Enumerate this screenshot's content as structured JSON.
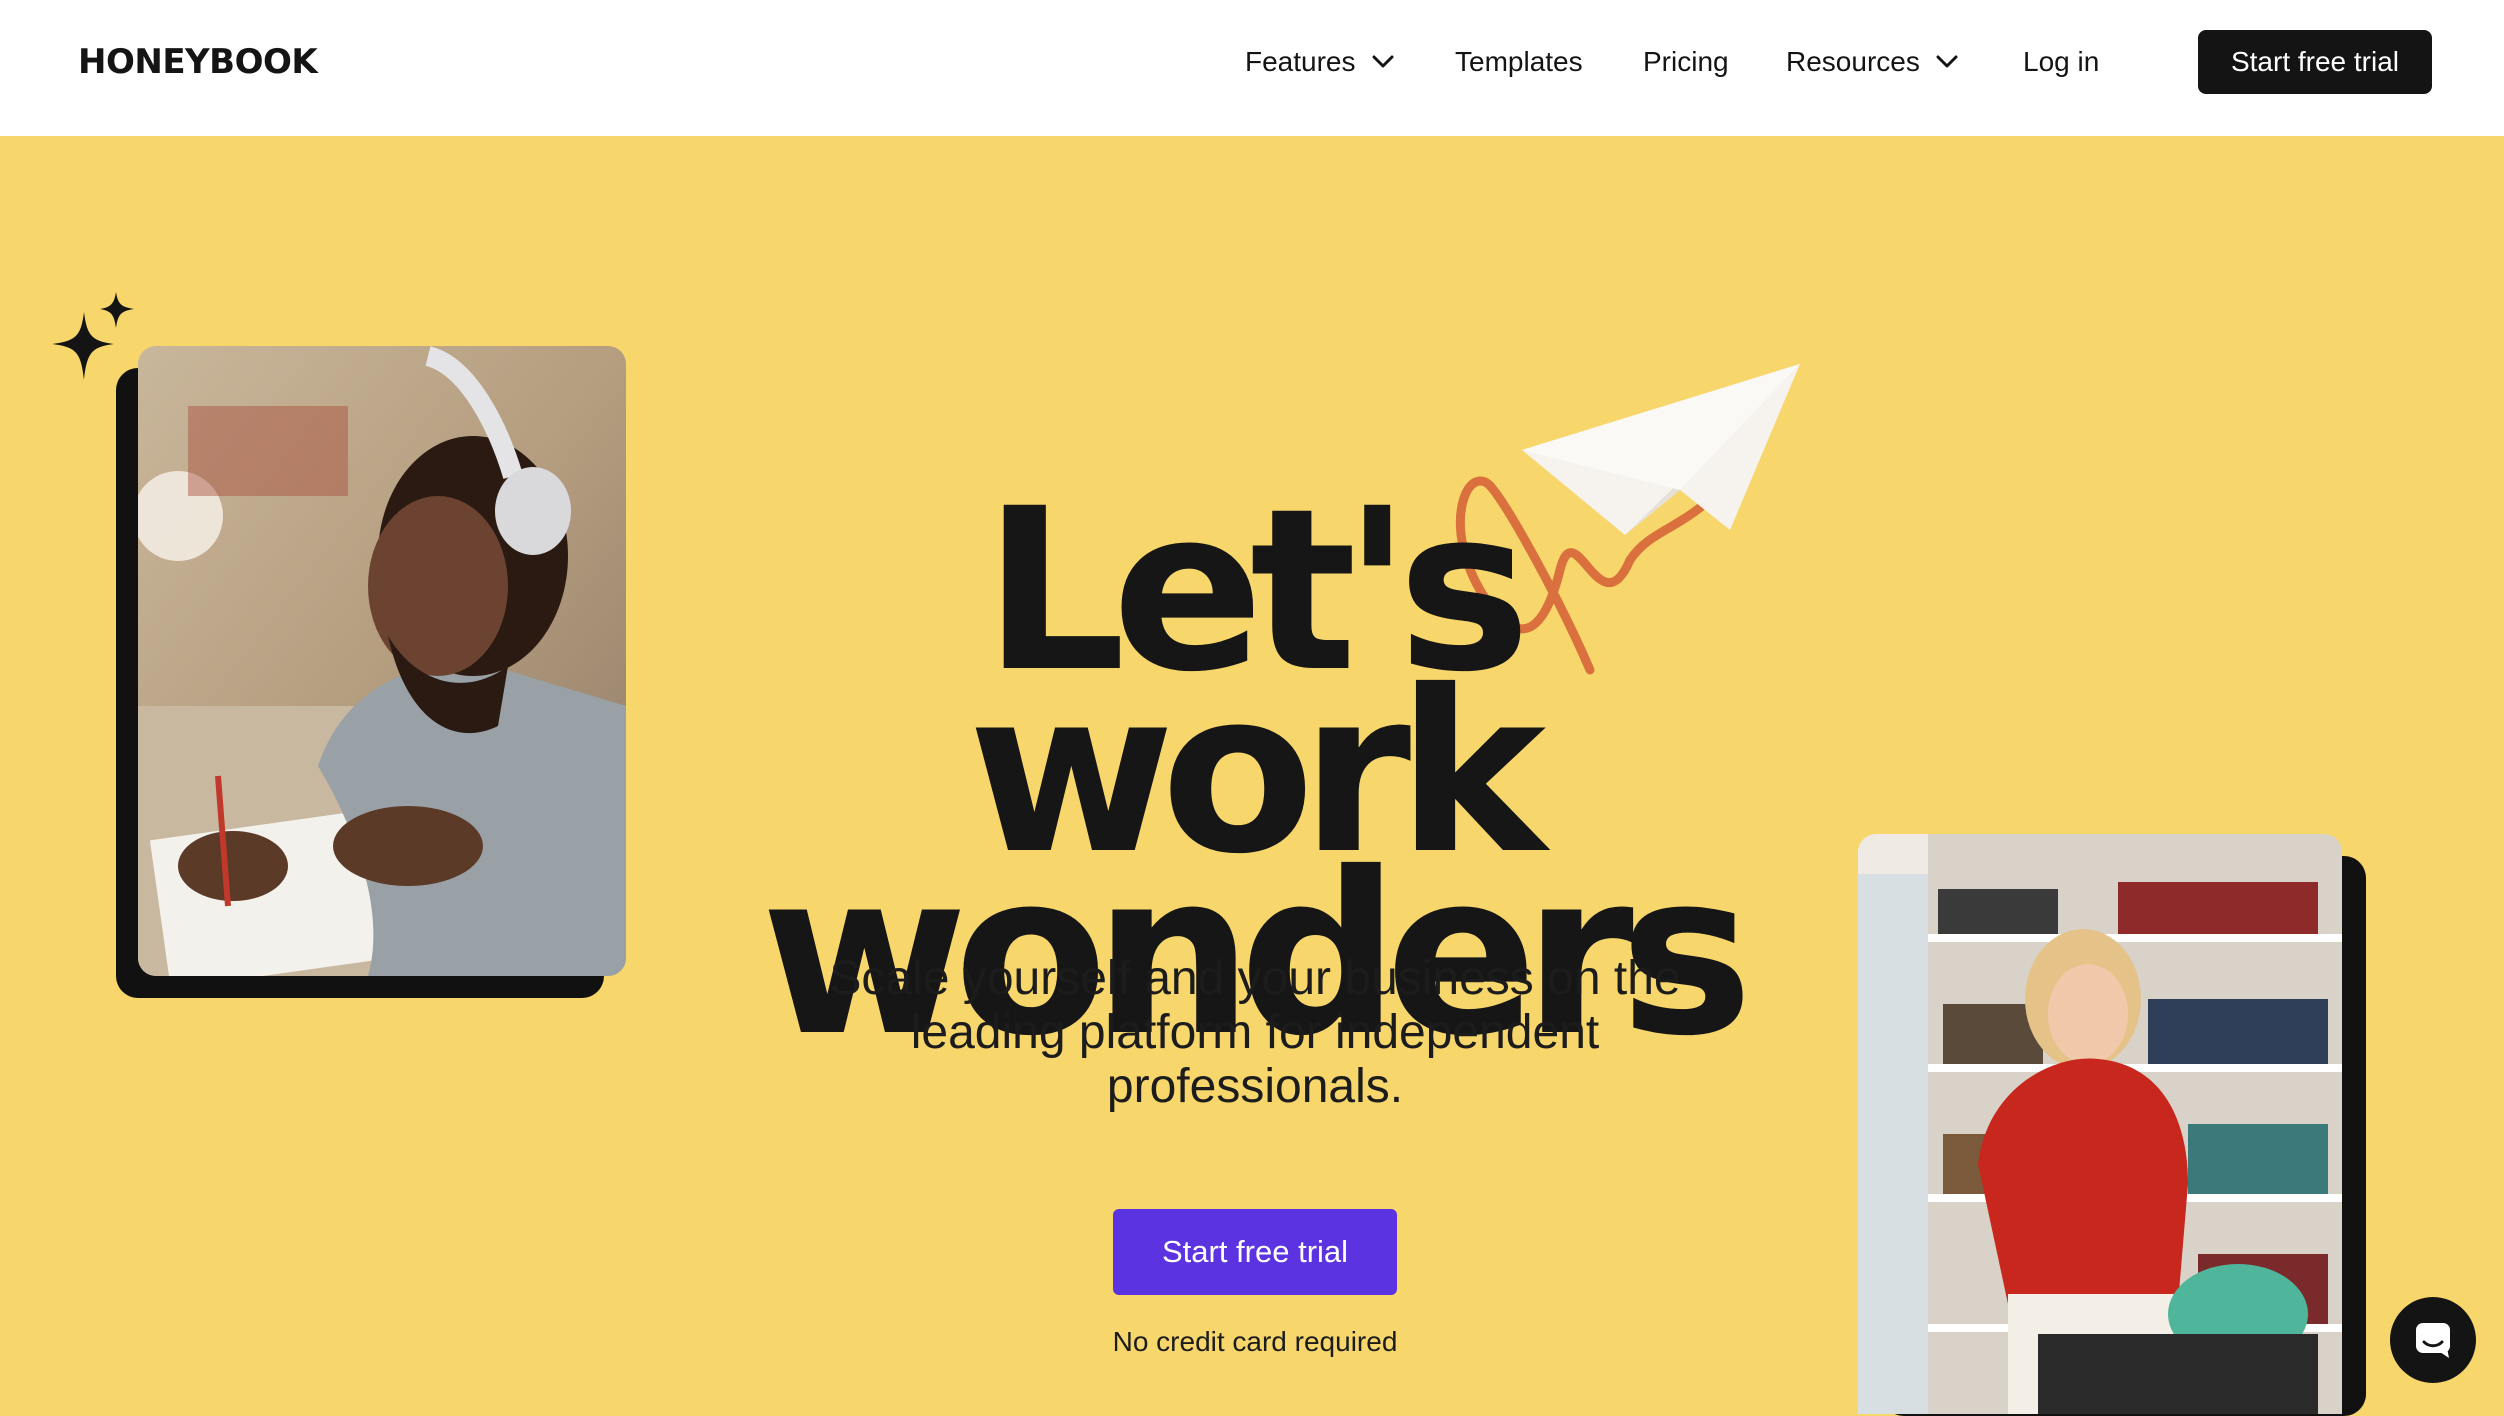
{
  "header": {
    "logo": "HONEYBOOK",
    "nav": [
      {
        "label": "Features",
        "has_dropdown": true,
        "icon": "chevron-down-icon"
      },
      {
        "label": "Templates",
        "has_dropdown": false
      },
      {
        "label": "Pricing",
        "has_dropdown": false
      },
      {
        "label": "Resources",
        "has_dropdown": true,
        "icon": "chevron-down-icon"
      },
      {
        "label": "Log in",
        "has_dropdown": false
      }
    ],
    "cta_label": "Start free trial"
  },
  "hero": {
    "headline_line1": "Let's work",
    "headline_line2": "wonders",
    "subheadline": "Scale yourself and your business on the leading platform for independent professionals.",
    "cta_label": "Start free trial",
    "cta_note": "No credit card required",
    "images": [
      "man-with-headphones-writing-photo",
      "woman-at-bookshelf-photo"
    ],
    "decorations": [
      "sparkle-icon",
      "paper-plane-icon",
      "squiggle-line"
    ]
  },
  "chat": {
    "icon": "chat-bubble-icon"
  },
  "colors": {
    "background": "#f7d66b",
    "header_bg": "#ffffff",
    "text": "#141414",
    "primary_cta": "#5b33e0",
    "header_cta": "#141414",
    "squiggle": "#d9703e"
  }
}
